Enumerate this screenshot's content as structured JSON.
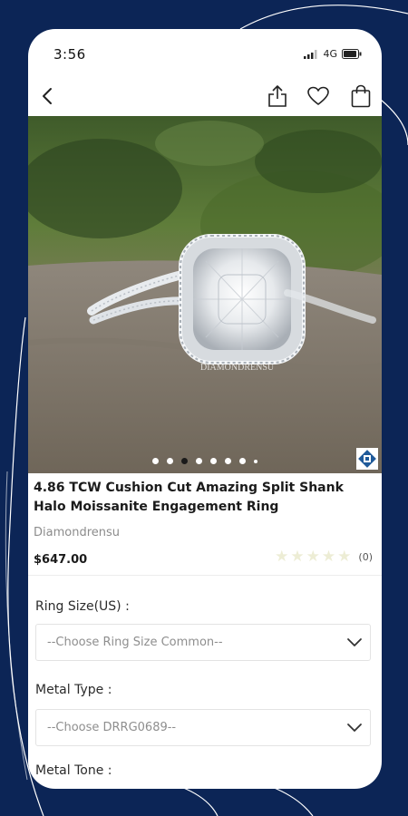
{
  "status_bar": {
    "time": "3:56",
    "network": "4G"
  },
  "app_bar": {
    "back_icon": "chevron-left-icon",
    "share_icon": "share-icon",
    "wishlist_icon": "heart-icon",
    "cart_icon": "shopping-bag-icon"
  },
  "hero": {
    "slide_count": 8,
    "active_slide": 3,
    "watermark": "DIAMONDRENSU"
  },
  "product": {
    "title": "4.86 TCW Cushion Cut Amazing Split Shank Halo Moissanite Engagement Ring",
    "brand": "Diamondrensu",
    "price": "$647.00",
    "rating_stars": 0,
    "rating_count": "(0)"
  },
  "options": [
    {
      "label": "Ring Size(US) :",
      "placeholder": "--Choose Ring Size Common--"
    },
    {
      "label": "Metal Type :",
      "placeholder": "--Choose DRRG0689--"
    },
    {
      "label": "Metal Tone :"
    }
  ],
  "colors": {
    "background": "#0c2556",
    "accent": "#1a1a1a"
  }
}
